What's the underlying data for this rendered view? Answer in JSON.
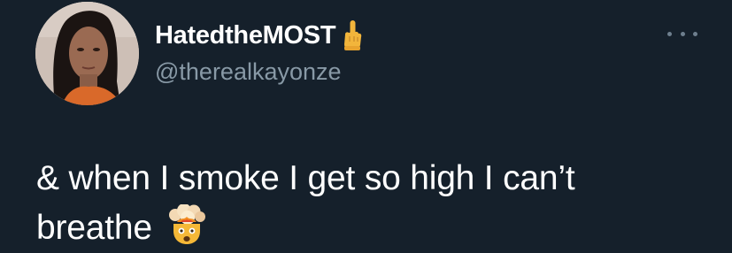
{
  "tweet": {
    "author": {
      "display_name": "HatedtheMOST",
      "display_name_emoji": "middle-finger-emoji",
      "username": "@therealkayonze",
      "avatar": "profile-photo"
    },
    "more_menu_icon": "more-horizontal-icon",
    "text_line1": "& when I smoke I get so high I can’t",
    "text_line2": "breathe",
    "text_emoji": "exploding-head-emoji",
    "colors": {
      "background": "#15202b",
      "primary_text": "#ffffff",
      "secondary_text": "#8899a6"
    }
  }
}
